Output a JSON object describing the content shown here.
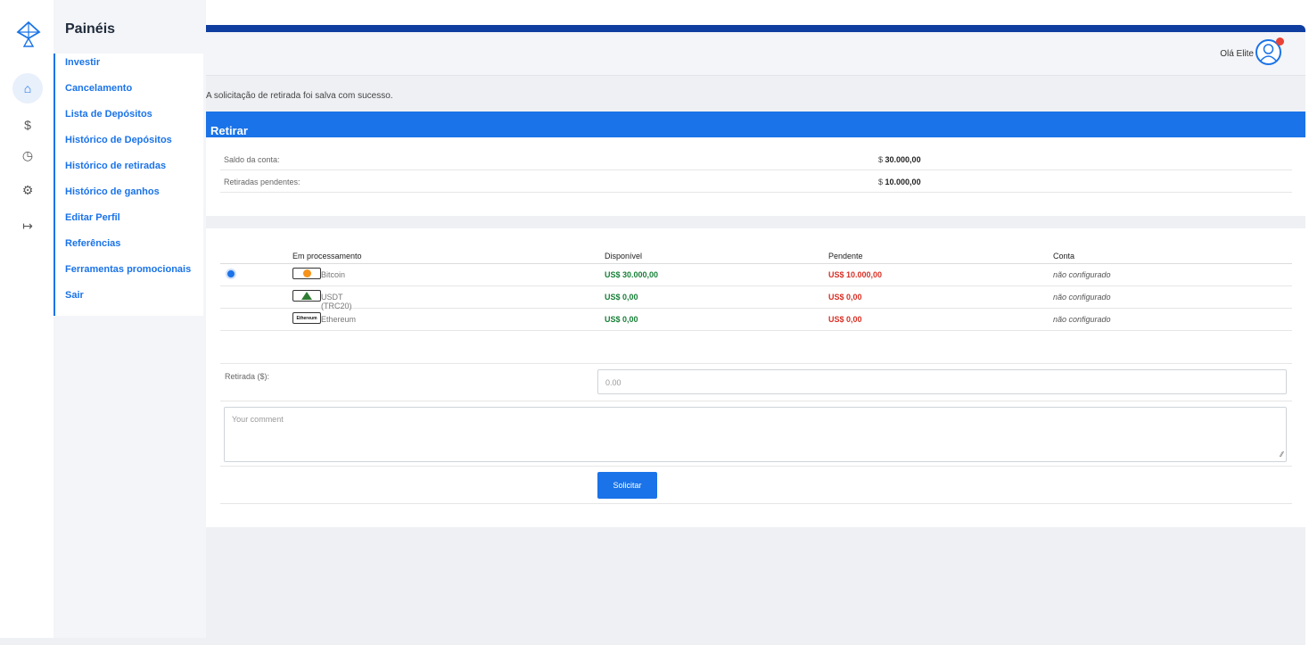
{
  "sidebar": {
    "title": "Painéis",
    "items": [
      {
        "label": "Investir"
      },
      {
        "label": "Cancelamento"
      },
      {
        "label": "Lista de Depósitos"
      },
      {
        "label": "Histórico de Depósitos"
      },
      {
        "label": "Histórico de retiradas"
      },
      {
        "label": "Histórico de ganhos"
      },
      {
        "label": "Editar Perfil"
      },
      {
        "label": "Referências"
      },
      {
        "label": "Ferramentas promocionais"
      },
      {
        "label": "Sair"
      }
    ]
  },
  "rail": {
    "icons": [
      "home-icon",
      "dollar-icon",
      "clock-icon",
      "gear-icon",
      "logout-icon"
    ],
    "glyphs": [
      "⌂",
      "$",
      "◷",
      "⚙",
      "↦"
    ]
  },
  "header": {
    "greeting": "Olá Elite"
  },
  "message": "A solicitação de retirada foi salva com sucesso.",
  "withdraw": {
    "title": "Retirar",
    "balance_label": "Saldo da conta:",
    "balance_currency": "$",
    "balance_value": "30.000,00",
    "pending_label": "Retiradas pendentes:",
    "pending_currency": "$",
    "pending_value": "10.000,00"
  },
  "processors": {
    "columns": [
      "Em processamento",
      "Disponível",
      "Pendente",
      "Conta"
    ],
    "rows": [
      {
        "name": "Bitcoin",
        "available": "US$ 30.000,00",
        "pending": "US$ 10.000,00",
        "account": "não configurado",
        "selected": true
      },
      {
        "name": "USDT (TRC20)",
        "available": "US$ 0,00",
        "pending": "US$ 0,00",
        "account": "não configurado",
        "selected": false
      },
      {
        "name": "Ethereum",
        "available": "US$ 0,00",
        "pending": "US$ 0,00",
        "account": "não configurado",
        "selected": false
      }
    ],
    "eth_badge_text": "Ethereum"
  },
  "form": {
    "amount_label": "Retirada ($):",
    "amount_placeholder": "0.00",
    "comment_placeholder": "Your comment",
    "submit_label": "Solicitar"
  },
  "colors": {
    "accent": "#1a73e8",
    "topbar": "#103ea0",
    "available": "#188038",
    "pending": "#d93025"
  }
}
